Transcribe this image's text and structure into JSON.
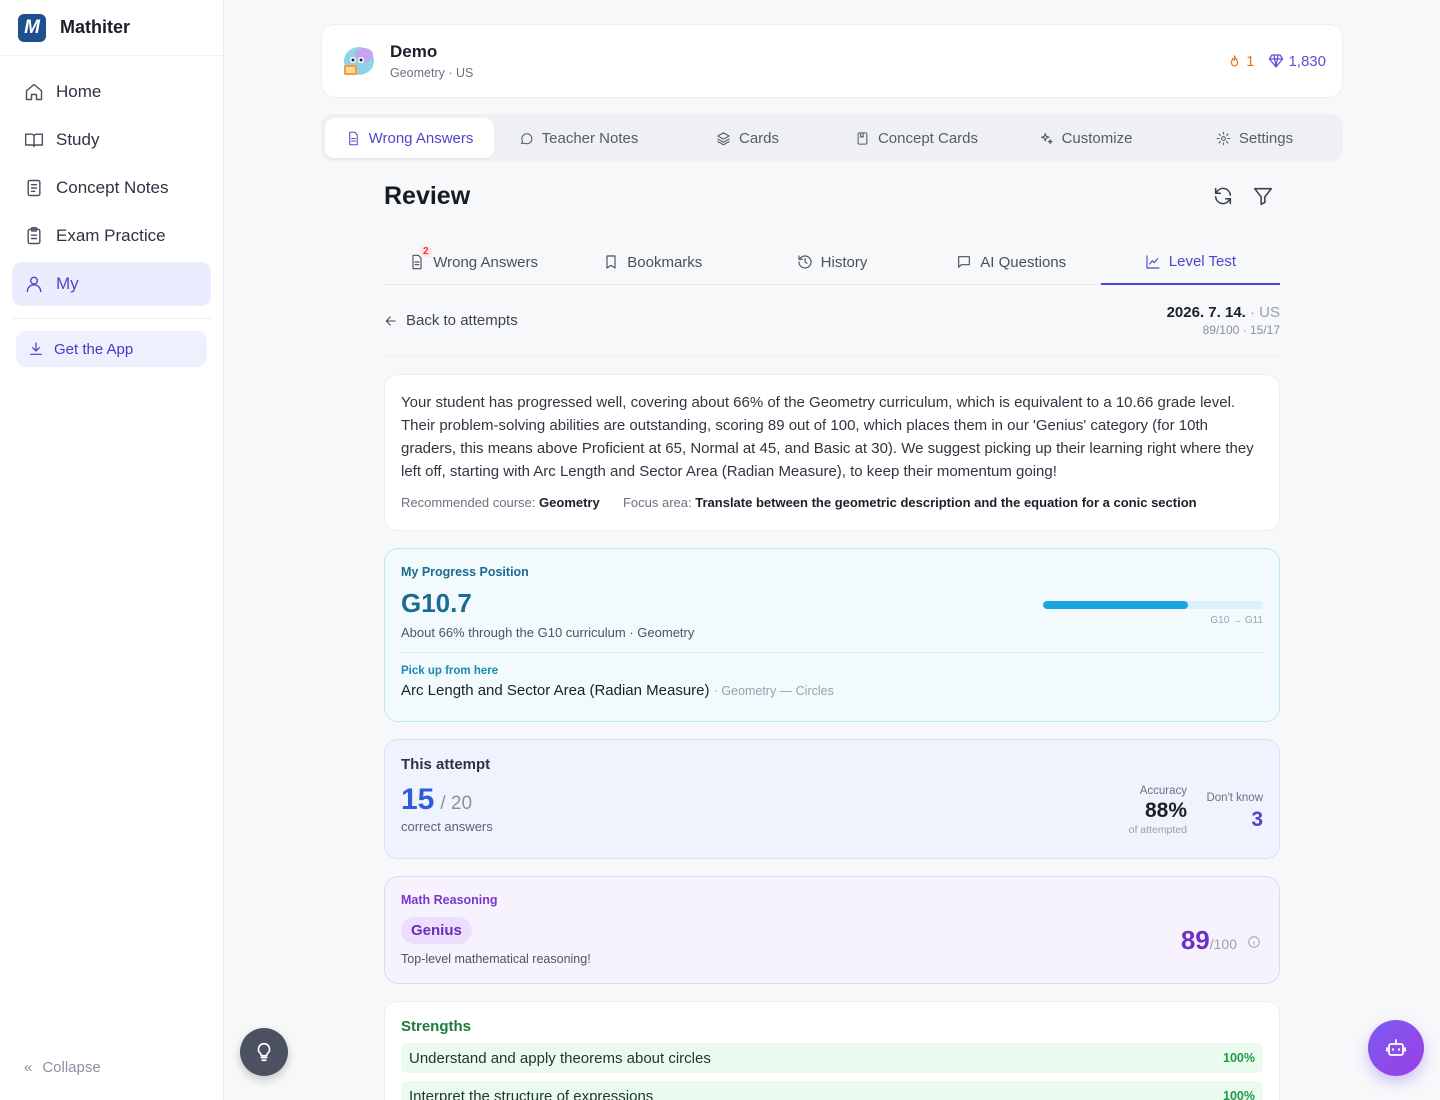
{
  "app": {
    "name": "Mathiter",
    "logo_letter": "M"
  },
  "sidebar": {
    "items": [
      {
        "label": "Home",
        "icon": "home-icon"
      },
      {
        "label": "Study",
        "icon": "book-icon"
      },
      {
        "label": "Concept Notes",
        "icon": "notes-icon"
      },
      {
        "label": "Exam Practice",
        "icon": "clipboard-icon"
      },
      {
        "label": "My",
        "icon": "user-icon",
        "active": true
      }
    ],
    "get_app": "Get the App",
    "collapse": "Collapse"
  },
  "profile": {
    "name": "Demo",
    "subtitle": "Geometry · US",
    "streak": "1",
    "gems": "1,830"
  },
  "top_tabs": [
    {
      "label": "Wrong Answers",
      "active": true
    },
    {
      "label": "Teacher Notes"
    },
    {
      "label": "Cards"
    },
    {
      "label": "Concept Cards"
    },
    {
      "label": "Customize"
    },
    {
      "label": "Settings"
    }
  ],
  "review": {
    "title": "Review",
    "sub_tabs": [
      {
        "label": "Wrong Answers",
        "badge": "2"
      },
      {
        "label": "Bookmarks"
      },
      {
        "label": "History"
      },
      {
        "label": "AI Questions"
      },
      {
        "label": "Level Test",
        "active": true
      }
    ]
  },
  "attempt": {
    "back_label": "Back to attempts",
    "date": "2026. 7. 14.",
    "region": "· US",
    "score_line": "89/100 · 15/17"
  },
  "summary": {
    "text": "Your student has progressed well, covering about 66% of the Geometry curriculum, which is equivalent to a 10.66 grade level. Their problem-solving abilities are outstanding, scoring 89 out of 100, which places them in our 'Genius' category (for 10th graders, this means above Proficient at 65, Normal at 45, and Basic at 30). We suggest picking up their learning right where they left off, starting with Arc Length and Sector Area (Radian Measure), to keep their momentum going!",
    "course_label": "Recommended course:",
    "course_value": "Geometry",
    "focus_label": "Focus area:",
    "focus_value": "Translate between the geometric description and the equation for a conic section"
  },
  "progress": {
    "label": "My Progress Position",
    "value": "G10.7",
    "desc": "About 66% through the G10 curriculum · Geometry",
    "bar_fraction": 0.66,
    "bar_caption": "G10 → G11",
    "pickup_label": "Pick up from here",
    "pickup_topic": "Arc Length and Sector Area (Radian Measure)",
    "pickup_context": "· Geometry — Circles"
  },
  "this_attempt": {
    "label": "This attempt",
    "correct": "15",
    "total": "/ 20",
    "caption": "correct answers",
    "accuracy_label": "Accuracy",
    "accuracy_value": "88%",
    "accuracy_caption": "of attempted",
    "dont_know_label": "Don't know",
    "dont_know_value": "3"
  },
  "reasoning": {
    "label": "Math Reasoning",
    "level": "Genius",
    "desc": "Top-level mathematical reasoning!",
    "score": "89",
    "max": "/100"
  },
  "strengths": {
    "title": "Strengths",
    "items": [
      {
        "label": "Understand and apply theorems about circles",
        "pct": "100%"
      },
      {
        "label": "Interpret the structure of expressions",
        "pct": "100%"
      }
    ]
  }
}
